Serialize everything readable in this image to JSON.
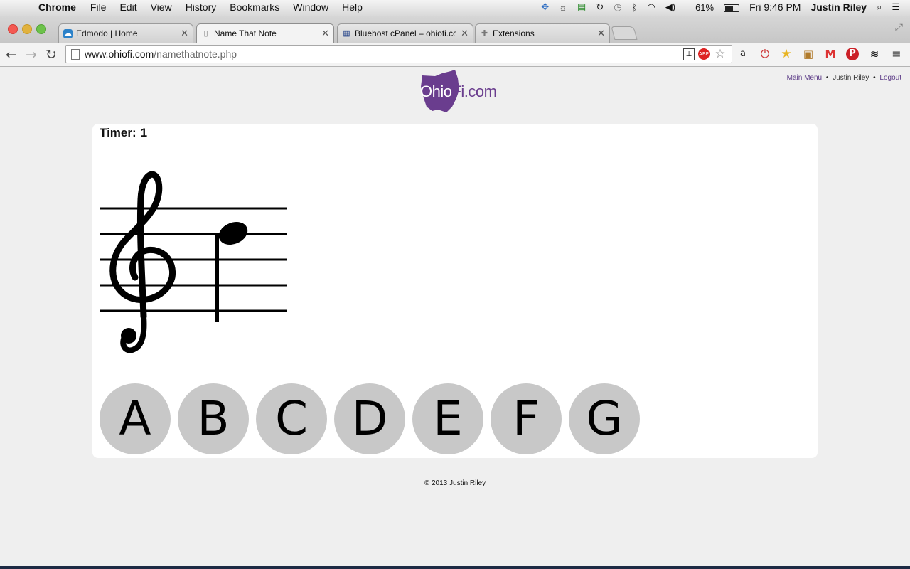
{
  "menubar": {
    "app_name": "Chrome",
    "menus": [
      "File",
      "Edit",
      "View",
      "History",
      "Bookmarks",
      "Window",
      "Help"
    ],
    "battery": "61%",
    "clock": "Fri 9:46 PM",
    "user": "Justin Riley"
  },
  "tabs": [
    {
      "title": "Edmodo | Home",
      "icon": "edmodo-icon",
      "active": false
    },
    {
      "title": "Name That Note",
      "icon": "page-icon",
      "active": true
    },
    {
      "title": "Bluehost cPanel – ohiofi.co",
      "icon": "cpanel-grid-icon",
      "active": false
    },
    {
      "title": "Extensions",
      "icon": "puzzle-icon",
      "active": false
    }
  ],
  "omnibox": {
    "host": "www.ohiofi.com",
    "path": "/namethatnote.php"
  },
  "header": {
    "logo_text_a": "Ohio",
    "logo_text_b": "Fi.com",
    "nav": {
      "main_menu": "Main Menu",
      "user": "Justin Riley",
      "logout": "Logout",
      "separator": "•"
    }
  },
  "game": {
    "timer_label": "Timer:",
    "timer_value": "1",
    "answers": [
      "A",
      "B",
      "C",
      "D",
      "E",
      "F",
      "G"
    ]
  },
  "footer": {
    "text": "© 2013 Justin Riley"
  },
  "colors": {
    "brand_purple": "#6a3d8e",
    "answer_button": "#c8c8c8",
    "page_background": "#efefef",
    "panel_background": "#ffffff"
  }
}
